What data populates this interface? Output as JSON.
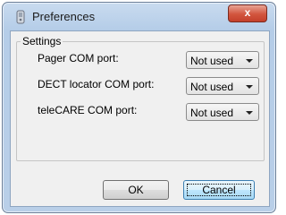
{
  "window": {
    "title": "Preferences",
    "close_label": "x"
  },
  "settings": {
    "group_label": "Settings",
    "rows": [
      {
        "label": "Pager COM port:",
        "value": "Not used"
      },
      {
        "label": "DECT locator COM port:",
        "value": "Not used"
      },
      {
        "label": "teleCARE COM port:",
        "value": "Not used"
      }
    ]
  },
  "buttons": {
    "ok": "OK",
    "cancel": "Cancel"
  },
  "icons": {
    "title": "app-icon",
    "close": "close-icon",
    "dropdown": "chevron-down-icon"
  }
}
